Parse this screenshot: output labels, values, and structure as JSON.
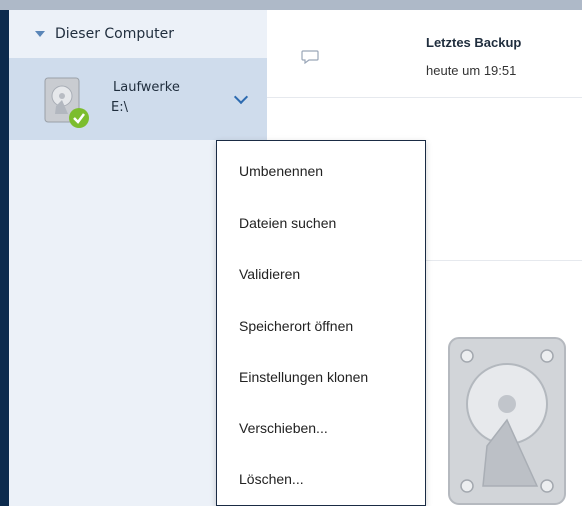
{
  "sidebar": {
    "header_title": "Dieser Computer",
    "drive": {
      "name": "Laufwerke",
      "path": "E:\\"
    }
  },
  "details": {
    "last_backup_label": "Letztes Backup",
    "last_backup_time": "heute um 19:51"
  },
  "context_menu": {
    "items": [
      "Umbenennen",
      "Dateien suchen",
      "Validieren",
      "Speicherort öffnen",
      "Einstellungen klonen",
      "Verschieben...",
      "Löschen..."
    ]
  },
  "colors": {
    "sidebar_bg": "#ecf1f8",
    "selected_item_bg": "#cfdcec",
    "accent_blue": "#2d6bb0",
    "left_bar": "#0c2a4d",
    "success_green": "#7cbd2e"
  },
  "icons": [
    "caret-down-icon",
    "hard-drive-icon",
    "check-badge-icon",
    "chevron-down-icon",
    "comment-icon",
    "hard-drive-large-icon"
  ]
}
